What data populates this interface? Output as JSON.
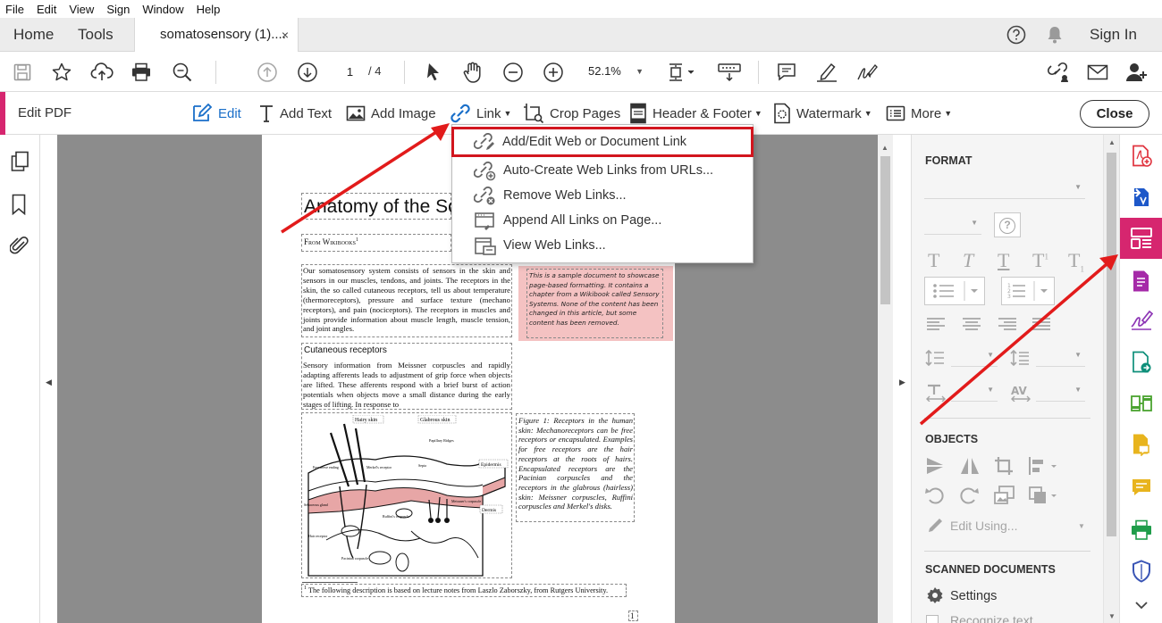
{
  "menubar": [
    "File",
    "Edit",
    "View",
    "Sign",
    "Window",
    "Help"
  ],
  "tabs": {
    "home": "Home",
    "tools": "Tools",
    "doc": "somatosensory (1)....",
    "close": "×",
    "sign_in": "Sign In"
  },
  "toolbar": {
    "page_current": "1",
    "page_total": "/  4",
    "zoom": "52.1%"
  },
  "editbar": {
    "title": "Edit PDF",
    "buttons": [
      "Edit",
      "Add Text",
      "Add Image",
      "Link",
      "Crop Pages",
      "Header & Footer",
      "Watermark",
      "More"
    ],
    "close": "Close"
  },
  "link_menu": [
    "Add/Edit Web or Document Link",
    "Auto-Create Web Links from URLs...",
    "Remove Web Links...",
    "Append All Links on Page...",
    "View Web Links..."
  ],
  "document": {
    "title": "Anatomy of the Somatosensory System",
    "from": "From Wikibooks",
    "from_sup": "1",
    "para1": "Our somatosensory system consists of sensors in the skin and sensors in our muscles, tendons, and joints. The receptors in the skin, the so called cutaneous receptors, tell us about temperature (thermoreceptors), pressure and surface texture (mechano receptors), and pain (nociceptors). The receptors in muscles and joints provide information about muscle length, muscle tension, and joint angles.",
    "heading": "Cutaneous receptors",
    "para2": "Sensory information from Meissner corpuscles and rapidly adapting afferents leads to adjustment of grip force when objects are lifted. These afferents respond with a brief burst of action potentials when objects move a small distance during the early stages of lifting. In response to",
    "note": "This is a sample document to showcase page-based formatting. It contains a chapter from a Wikibook called Sensory Systems. None of the content has been changed in this article, but some content has been removed.",
    "caption": "Figure 1: Receptors in the human skin: Mechanoreceptors can be free receptors or encapsulated. Examples for free receptors are the hair receptors at the roots of hairs. Encapsulated receptors are the Pacinian corpuscles and the receptors in the glabrous (hairless) skin: Meissner corpuscles, Ruffini corpuscles and Merkel's disks.",
    "fig_labels": [
      "Hairy skin",
      "Glabrous skin",
      "Papillary Ridges",
      "Epidermis",
      "Dermis",
      "Free nerve ending",
      "Merkel's receptor",
      "Septa",
      "Sebaceous gland",
      "Ruffini's corpuscle",
      "Meissner's corpuscle",
      "Hair receptor",
      "Pacinian corpuscle"
    ],
    "footnote_sup": "1",
    "footnote": "The following description is based on lecture notes from Laszlo Zaborszky, from Rutgers University.",
    "page_number": "1"
  },
  "format_panel": {
    "format_title": "FORMAT",
    "objects_title": "OBJECTS",
    "edit_using": "Edit Using...",
    "scanned_title": "SCANNED DOCUMENTS",
    "settings": "Settings",
    "recognize": "Recognize text",
    "help_glyph": "?"
  },
  "colors": {
    "accent": "#d6266f",
    "link_blue": "#1a6fc9",
    "highlight_red": "#d2151e",
    "arrow_red": "#e21b1b"
  }
}
